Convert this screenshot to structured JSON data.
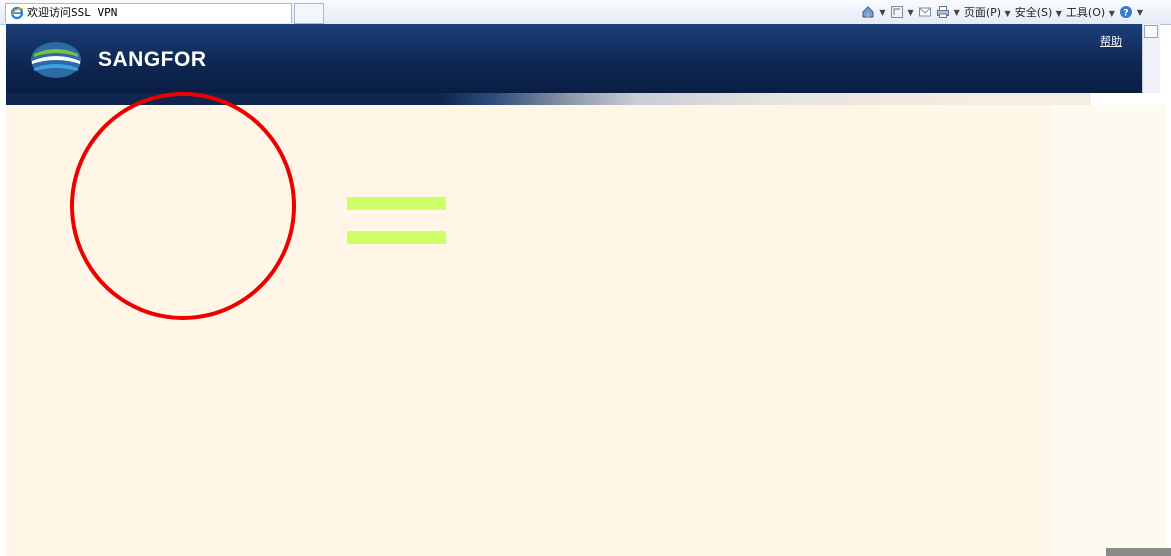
{
  "browser": {
    "tab_title": "欢迎访问SSL VPN",
    "menu_page": "页面(P)",
    "menu_safety": "安全(S)",
    "menu_tools": "工具(O)",
    "icons": [
      "home-icon",
      "feeds-icon",
      "mail-icon",
      "print-icon",
      "help-icon"
    ]
  },
  "header": {
    "brand": "SANGFOR",
    "help_link": "帮助"
  },
  "colors": {
    "banner": "#0e2650",
    "content_bg": "#fff6e8",
    "accent_button": "#cfff66",
    "annotation": "#ee0000"
  },
  "annotation": {
    "shape": "red-circle"
  }
}
